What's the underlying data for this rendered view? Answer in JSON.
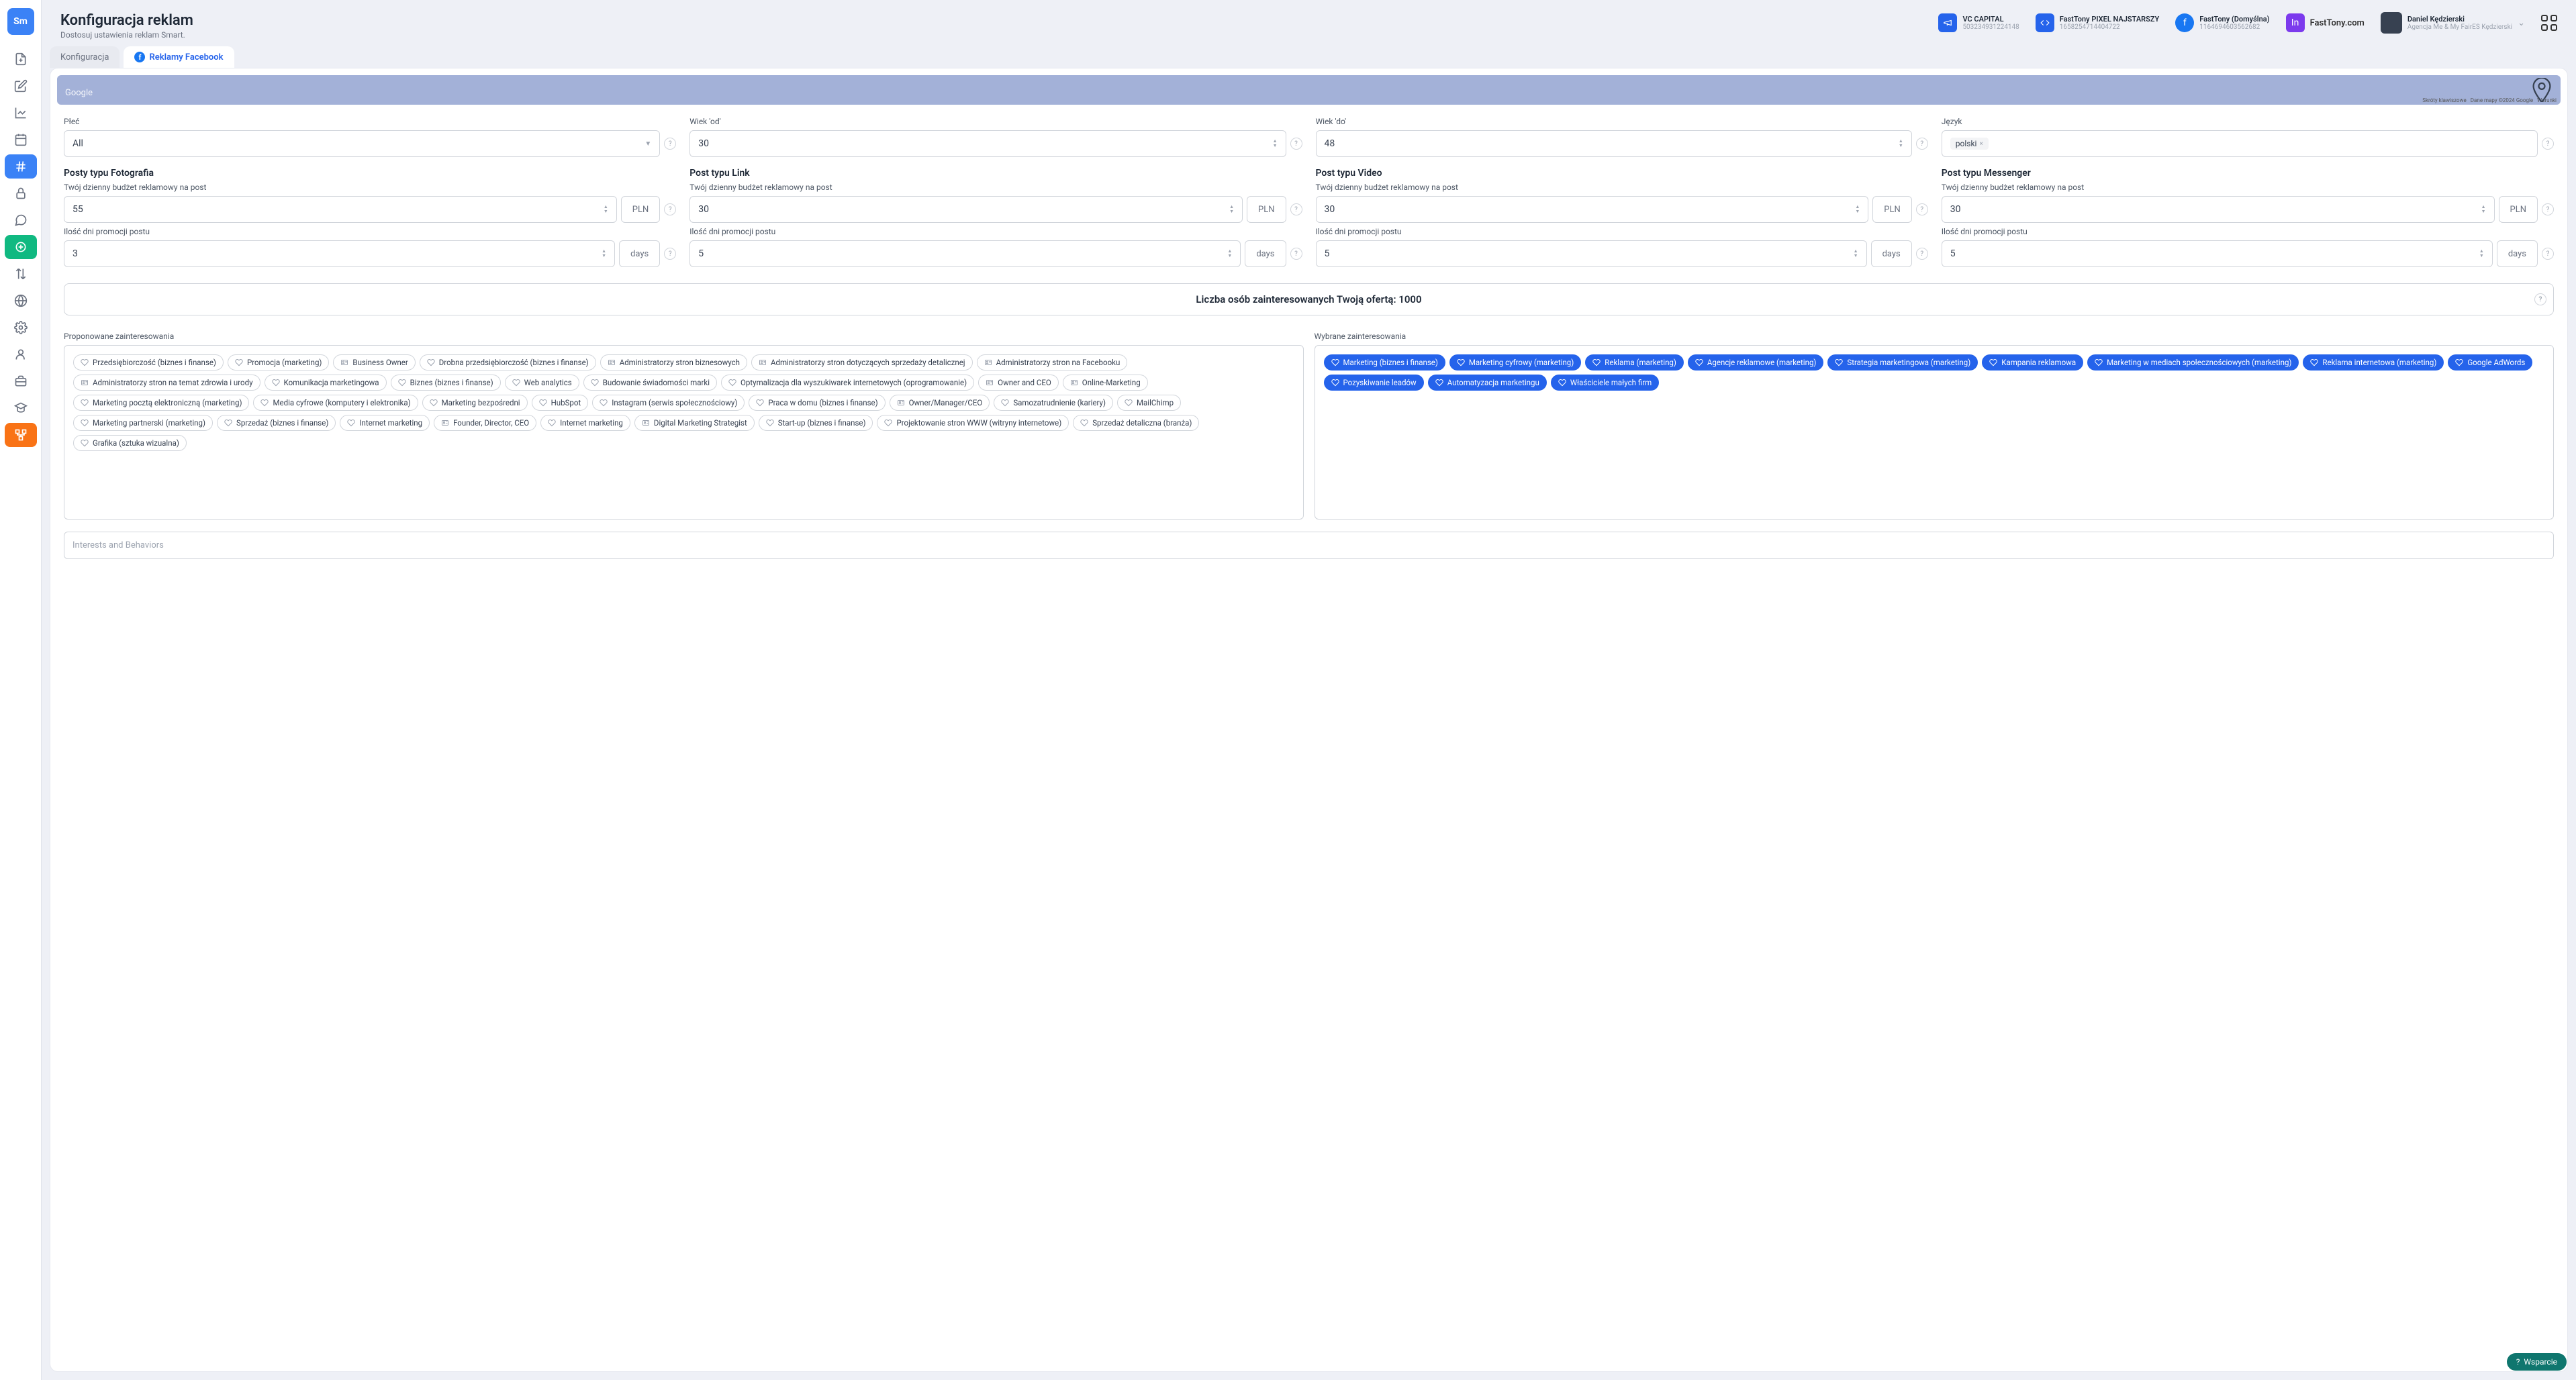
{
  "header": {
    "title": "Konfiguracja reklam",
    "subtitle": "Dostosuj ustawienia reklam Smart."
  },
  "topAccounts": {
    "vc": {
      "name": "VC CAPITAL",
      "id": "503234931224148"
    },
    "pixel": {
      "name": "FastTony PIXEL NAJSTARSZY",
      "id": "1658254714404722"
    },
    "account": {
      "name": "FastTony (Domyślna)",
      "id": "1164694603562682"
    },
    "brand": "FastTony.com",
    "user": {
      "name": "Daniel Kędzierski",
      "role": "Agencja Me & My FairES Kędzierski"
    }
  },
  "tabs": {
    "config": "Konfiguracja",
    "fb": "Reklamy Facebook"
  },
  "map": {
    "provider": "Google",
    "shortcuts": "Skróty klawiszowe",
    "attrib": "Dane mapy ©2024 Google",
    "terms": "Warunki"
  },
  "demo": {
    "gender_label": "Płeć",
    "gender_value": "All",
    "age_from_label": "Wiek 'od'",
    "age_from": "30",
    "age_to_label": "Wiek 'do'",
    "age_to": "48",
    "lang_label": "Język",
    "lang_value": "polski"
  },
  "posts": {
    "photo": {
      "title": "Posty typu Fotografia",
      "budget_label": "Twój dzienny budżet reklamowy na post",
      "budget": "55",
      "currency": "PLN",
      "days_label": "Ilość dni promocji postu",
      "days": "3",
      "days_unit": "days"
    },
    "link": {
      "title": "Post typu Link",
      "budget_label": "Twój dzienny budżet reklamowy na post",
      "budget": "30",
      "currency": "PLN",
      "days_label": "Ilość dni promocji postu",
      "days": "5",
      "days_unit": "days"
    },
    "video": {
      "title": "Post typu Video",
      "budget_label": "Twój dzienny budżet reklamowy na post",
      "budget": "30",
      "currency": "PLN",
      "days_label": "Ilość dni promocji postu",
      "days": "5",
      "days_unit": "days"
    },
    "messenger": {
      "title": "Post typu Messenger",
      "budget_label": "Twój dzienny budżet reklamowy na post",
      "budget": "30",
      "currency": "PLN",
      "days_label": "Ilość dni promocji postu",
      "days": "5",
      "days_unit": "days"
    }
  },
  "audience_text": "Liczba osób zainteresowanych Twoją ofertą: 1000",
  "suggested_label": "Proponowane zainteresowania",
  "selected_label": "Wybrane zainteresowania",
  "suggested": [
    "Przedsiębiorczość (biznes i finanse)",
    "Promocja (marketing)",
    "Business Owner",
    "Drobna przedsiębiorczość (biznes i finanse)",
    "Administratorzy stron biznesowych",
    "Administratorzy stron dotyczących sprzedaży detalicznej",
    "Administratorzy stron na Facebooku",
    "Administratorzy stron na temat zdrowia i urody",
    "Komunikacja marketingowa",
    "Biznes (biznes i finanse)",
    "Web analytics",
    "Budowanie świadomości marki",
    "Optymalizacja dla wyszukiwarek internetowych (oprogramowanie)",
    "Owner and CEO",
    "Online-Marketing",
    "Marketing pocztą elektroniczną (marketing)",
    "Media cyfrowe (komputery i elektronika)",
    "Marketing bezpośredni",
    "HubSpot",
    "Instagram (serwis społecznościowy)",
    "Praca w domu (biznes i finanse)",
    "Owner/Manager/CEO",
    "Samozatrudnienie (kariery)",
    "MailChimp",
    "Marketing partnerski (marketing)",
    "Sprzedaż (biznes i finanse)",
    "Internet marketing",
    "Founder, Director, CEO",
    "Internet marketing",
    "Digital Marketing Strategist",
    "Start-up (biznes i finanse)",
    "Projektowanie stron WWW (witryny internetowe)",
    "Sprzedaż detaliczna (branża)",
    "Grafika (sztuka wizualna)"
  ],
  "selected": [
    "Marketing (biznes i finanse)",
    "Marketing cyfrowy (marketing)",
    "Reklama (marketing)",
    "Agencje reklamowe (marketing)",
    "Strategia marketingowa (marketing)",
    "Kampania reklamowa",
    "Marketing w mediach społecznościowych (marketing)",
    "Reklama internetowa (marketing)",
    "Google AdWords",
    "Pozyskiwanie leadów",
    "Automatyzacja marketingu",
    "Właściciele małych firm"
  ],
  "search_placeholder": "Interests and Behaviors",
  "support_label": "Wsparcie"
}
